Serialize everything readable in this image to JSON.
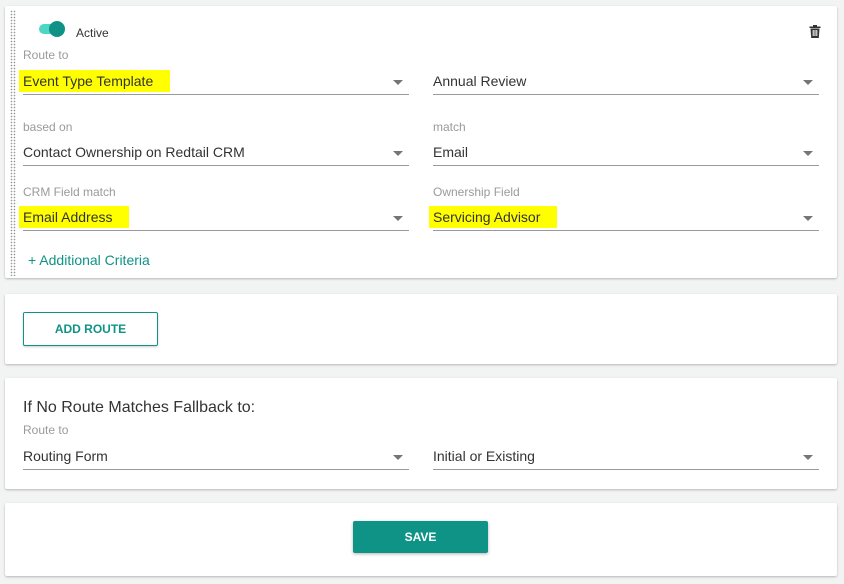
{
  "route": {
    "active": true,
    "active_label": "Active",
    "delete_icon": "trash-icon",
    "route_to": {
      "label": "Route to",
      "type_value": "Event Type Template",
      "target_value": "Annual Review"
    },
    "based_on": {
      "label": "based on",
      "value": "Contact Ownership on Redtail CRM"
    },
    "match": {
      "label": "match",
      "value": "Email"
    },
    "crm_field_match": {
      "label": "CRM Field match",
      "value": "Email Address"
    },
    "ownership_field": {
      "label": "Ownership Field",
      "value": "Servicing Advisor"
    },
    "additional_criteria_label": "+ Additional Criteria"
  },
  "add_route_label": "ADD ROUTE",
  "fallback": {
    "title": "If No Route Matches Fallback to:",
    "route_to": {
      "label": "Route to",
      "type_value": "Routing Form",
      "target_value": "Initial or Existing"
    }
  },
  "save_label": "SAVE",
  "colors": {
    "accent": "#0f9386",
    "toggle_track": "#4dd6c4",
    "highlight": "#ffff00"
  }
}
